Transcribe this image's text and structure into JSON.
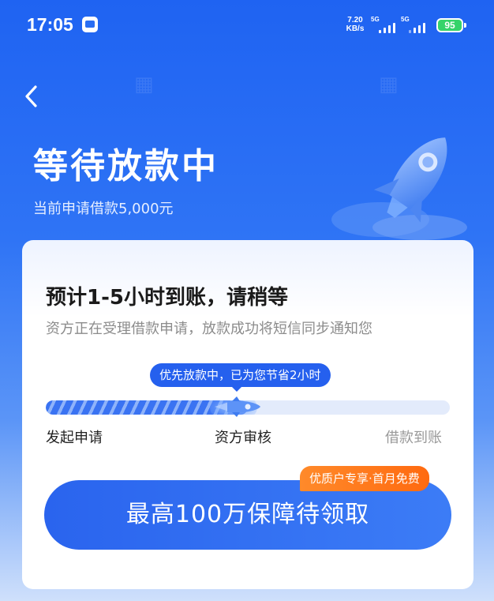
{
  "status_bar": {
    "time": "17:05",
    "net_speed_value": "7.20",
    "net_speed_unit": "KB/s",
    "signal_1_label": "5G",
    "signal_2_label": "5G",
    "battery": "95"
  },
  "header": {
    "title": "等待放款中",
    "subtitle": "当前申请借款5,000元"
  },
  "card": {
    "title": "预计1-5小时到账，请稍等",
    "description": "资方正在受理借款申请，放款成功将短信同步通知您",
    "progress_tip": "优先放款中，已为您节省2小时",
    "progress_fraction": 0.5,
    "steps": [
      {
        "label": "发起申请",
        "state": "done"
      },
      {
        "label": "资方审核",
        "state": "current"
      },
      {
        "label": "借款到账",
        "state": "pending"
      }
    ],
    "cta_label": "最高100万保障待领取",
    "cta_tag": "优质户专享·首月免费"
  },
  "colors": {
    "primary": "#2560ee",
    "accent_orange": "#ff7a1a",
    "battery_green": "#36d36a"
  }
}
